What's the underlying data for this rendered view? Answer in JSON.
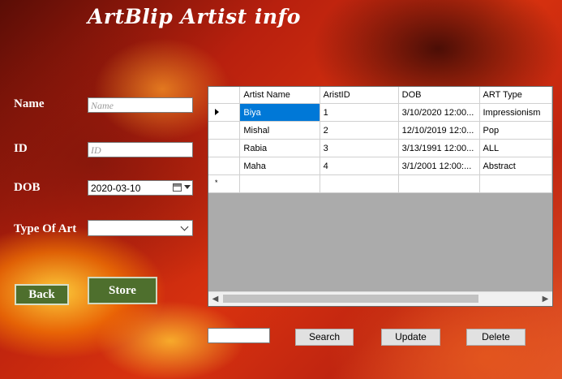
{
  "app": {
    "title": "ArtBlip Artist info"
  },
  "form": {
    "name_label": "Name",
    "name_placeholder": "Name",
    "id_label": "ID",
    "id_placeholder": "ID",
    "dob_label": "DOB",
    "dob_value": "2020-03-10",
    "type_label": "Type Of Art",
    "type_value": ""
  },
  "buttons": {
    "back": "Back",
    "store": "Store",
    "search": "Search",
    "update": "Update",
    "delete": "Delete"
  },
  "search": {
    "value": ""
  },
  "grid": {
    "columns": [
      "Artist Name",
      "AristID",
      "DOB",
      "ART Type"
    ],
    "rows": [
      [
        "Biya",
        "1",
        "3/10/2020 12:00...",
        "Impressionism"
      ],
      [
        "Mishal",
        "2",
        "12/10/2019 12:0...",
        "Pop"
      ],
      [
        "Rabia",
        "3",
        "3/13/1991 12:00...",
        "ALL"
      ],
      [
        "Maha",
        "4",
        "3/1/2001 12:00:...",
        "Abstract"
      ]
    ],
    "new_row_marker": "*"
  },
  "icons": [
    "calendar-icon",
    "dropdown-arrow-icon",
    "chevron-down-icon",
    "row-selector-arrow-icon",
    "scroll-left-icon",
    "scroll-right-icon"
  ],
  "colors": {
    "button_green": "#4e6f2d",
    "selection_blue": "#0078d7",
    "grid_background": "#ababab"
  }
}
